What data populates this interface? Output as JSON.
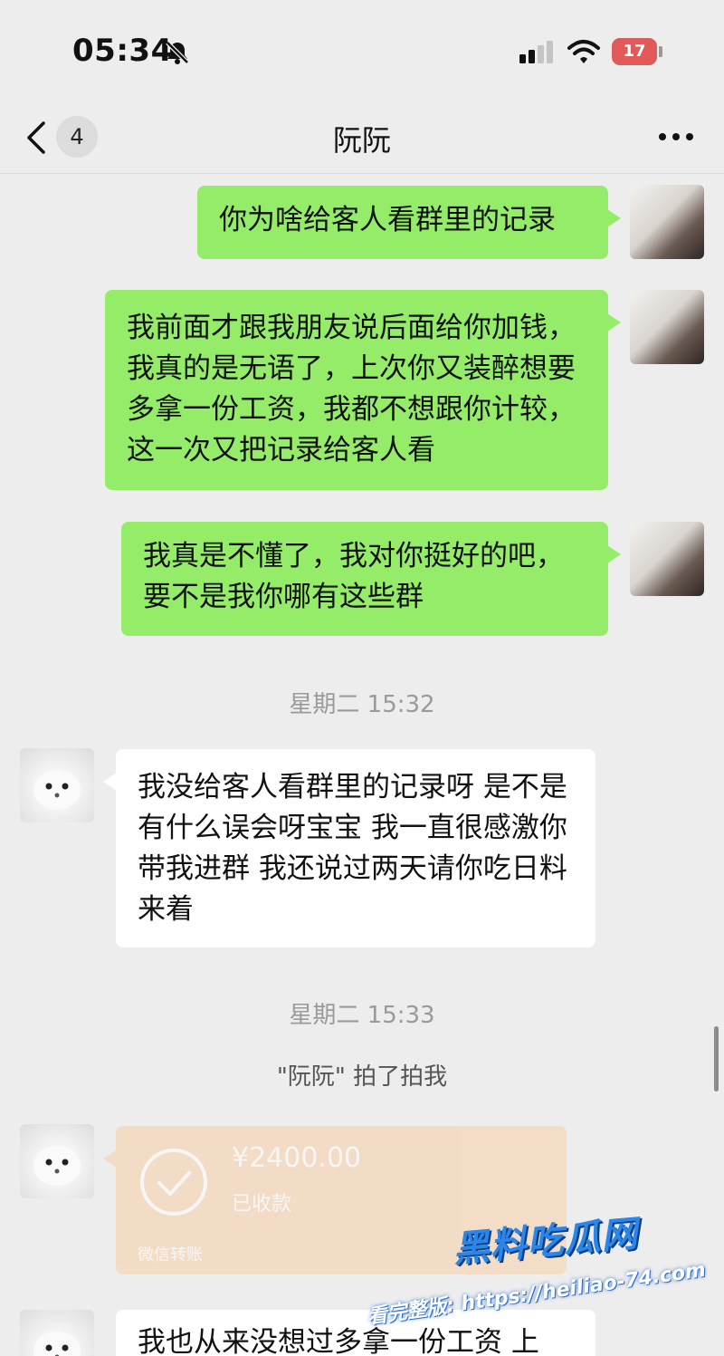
{
  "status_bar": {
    "time": "05:34",
    "battery": "17"
  },
  "nav": {
    "unread_count": "4",
    "title": "阮阮"
  },
  "messages": [
    {
      "from": "self",
      "text": "你为啥给客人看群里的记录"
    },
    {
      "from": "self",
      "text": "我前面才跟我朋友说后面给你加钱，我真的是无语了，上次你又装醉想要多拿一份工资，我都不想跟你计较，这一次又把记录给客人看"
    },
    {
      "from": "self",
      "text": "我真是不懂了，我对你挺好的吧，要不是我你哪有这些群"
    },
    {
      "from": "other",
      "text": "我没给客人看群里的记录呀 是不是有什么误会呀宝宝 我一直很感激你带我进群 我还说过两天请你吃日料来着"
    },
    {
      "from": "other",
      "text": "我也从来没想过多拿一份工资 上"
    }
  ],
  "timestamps": [
    "星期二 15:32",
    "星期二 15:33"
  ],
  "system_message": "\"阮阮\" 拍了拍我",
  "transfer": {
    "amount": "¥2400.00",
    "status": "已收款",
    "footer": "微信转账"
  },
  "watermark": {
    "title": "黑料吃瓜网",
    "url": "看完整版: https://heiliao-74.com"
  },
  "colors": {
    "self_bubble": "#95ec69",
    "other_bubble": "#ffffff",
    "background": "#ededed",
    "battery": "#e05a5a"
  },
  "icons": {
    "back": "chevron-left-icon",
    "more": "more-dots-icon",
    "mute": "bell-slash-icon",
    "wifi": "wifi-icon",
    "signal": "signal-icon",
    "check": "check-circle-icon"
  }
}
